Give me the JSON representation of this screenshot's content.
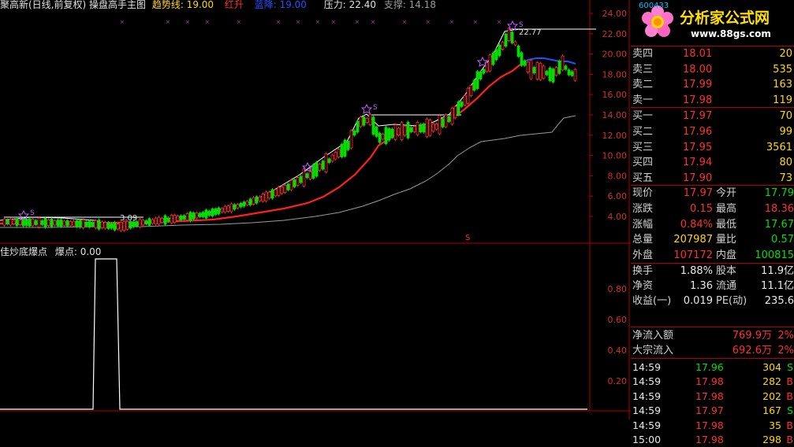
{
  "main_indicator": {
    "title": "聚高新(日线,前复权) 操盘高手主图",
    "trend_label": "趋势线: 19.00",
    "red_label": "红升",
    "blue_label": "蓝降: 19.00",
    "pressure_label": "压力: 22.40",
    "support_label": "支撑: 14.18",
    "peak_label": "22.77",
    "low_label": "3.09",
    "marker_s": "S",
    "price_axis": [
      "24.00",
      "22.00",
      "20.00",
      "18.00",
      "16.00",
      "14.00",
      "12.00",
      "10.00",
      "8.00",
      "6.00",
      "4.00"
    ]
  },
  "sub_indicator": {
    "title": "佳炒底爆点",
    "value_label": "爆点: 0.00",
    "axis": [
      "0.80",
      "0.60",
      "0.40",
      "0.20"
    ]
  },
  "quote": {
    "code_label": "600433",
    "logo_text": "分析家公式网",
    "logo_url": "www.88gs.com",
    "sell": [
      {
        "label": "卖四",
        "price": "18.01",
        "vol": "20"
      },
      {
        "label": "卖三",
        "price": "18.00",
        "vol": "535"
      },
      {
        "label": "卖二",
        "price": "17.99",
        "vol": "163"
      },
      {
        "label": "卖一",
        "price": "17.98",
        "vol": "119"
      }
    ],
    "buy": [
      {
        "label": "买一",
        "price": "17.97",
        "vol": "70"
      },
      {
        "label": "买二",
        "price": "17.96",
        "vol": "99"
      },
      {
        "label": "买三",
        "price": "17.95",
        "vol": "3561"
      },
      {
        "label": "买四",
        "price": "17.94",
        "vol": "80"
      },
      {
        "label": "买五",
        "price": "17.90",
        "vol": "73"
      }
    ],
    "stats": [
      {
        "l1": "现价",
        "v1": "17.97",
        "l2": "今开",
        "v2": "17.79",
        "c1": "red",
        "c2": "green"
      },
      {
        "l1": "涨跌",
        "v1": "0.15",
        "l2": "最高",
        "v2": "18.36",
        "c1": "red",
        "c2": "red"
      },
      {
        "l1": "涨幅",
        "v1": "0.84%",
        "l2": "最低",
        "v2": "17.67",
        "c1": "red",
        "c2": "green"
      },
      {
        "l1": "总量",
        "v1": "207987",
        "l2": "量比",
        "v2": "0.57",
        "c1": "yellow",
        "c2": "green"
      },
      {
        "l1": "外盘",
        "v1": "107172",
        "l2": "内盘",
        "v2": "100815",
        "c1": "red",
        "c2": "green"
      }
    ],
    "fund": [
      {
        "l1": "换手",
        "v1": "1.88%",
        "l2": "股本",
        "v2": "11.9亿"
      },
      {
        "l1": "净资",
        "v1": "1.36",
        "l2": "流通",
        "v2": "11.1亿"
      },
      {
        "l1": "收益(一)",
        "v1": "0.019",
        "l2": "PE(动)",
        "v2": "235.6"
      }
    ],
    "flow": [
      {
        "label": "净流入额",
        "value": "769.9万",
        "pct": "2%"
      },
      {
        "label": "大宗流入",
        "value": "692.6万",
        "pct": "2%"
      }
    ],
    "ticks": [
      {
        "time": "14:59",
        "price": "17.96",
        "vol": "304",
        "side": "S",
        "pc": "green",
        "sc": "green"
      },
      {
        "time": "14:59",
        "price": "17.98",
        "vol": "282",
        "side": "B",
        "pc": "red",
        "sc": "red"
      },
      {
        "time": "14:59",
        "price": "17.98",
        "vol": "202",
        "side": "B",
        "pc": "red",
        "sc": "red"
      },
      {
        "time": "14:59",
        "price": "17.97",
        "vol": "167",
        "side": "S",
        "pc": "red",
        "sc": "green"
      },
      {
        "time": "14:59",
        "price": "17.98",
        "vol": "35",
        "side": "B",
        "pc": "red",
        "sc": "red"
      },
      {
        "time": "15:00",
        "price": "17.98",
        "vol": "298",
        "side": "B",
        "pc": "red",
        "sc": "red"
      }
    ]
  },
  "colors": {
    "up": "#ff3030",
    "down": "#00e000",
    "bg": "#000000",
    "grid": "#b00000",
    "ma": "#ff2020",
    "trend": "#2050ff"
  }
}
